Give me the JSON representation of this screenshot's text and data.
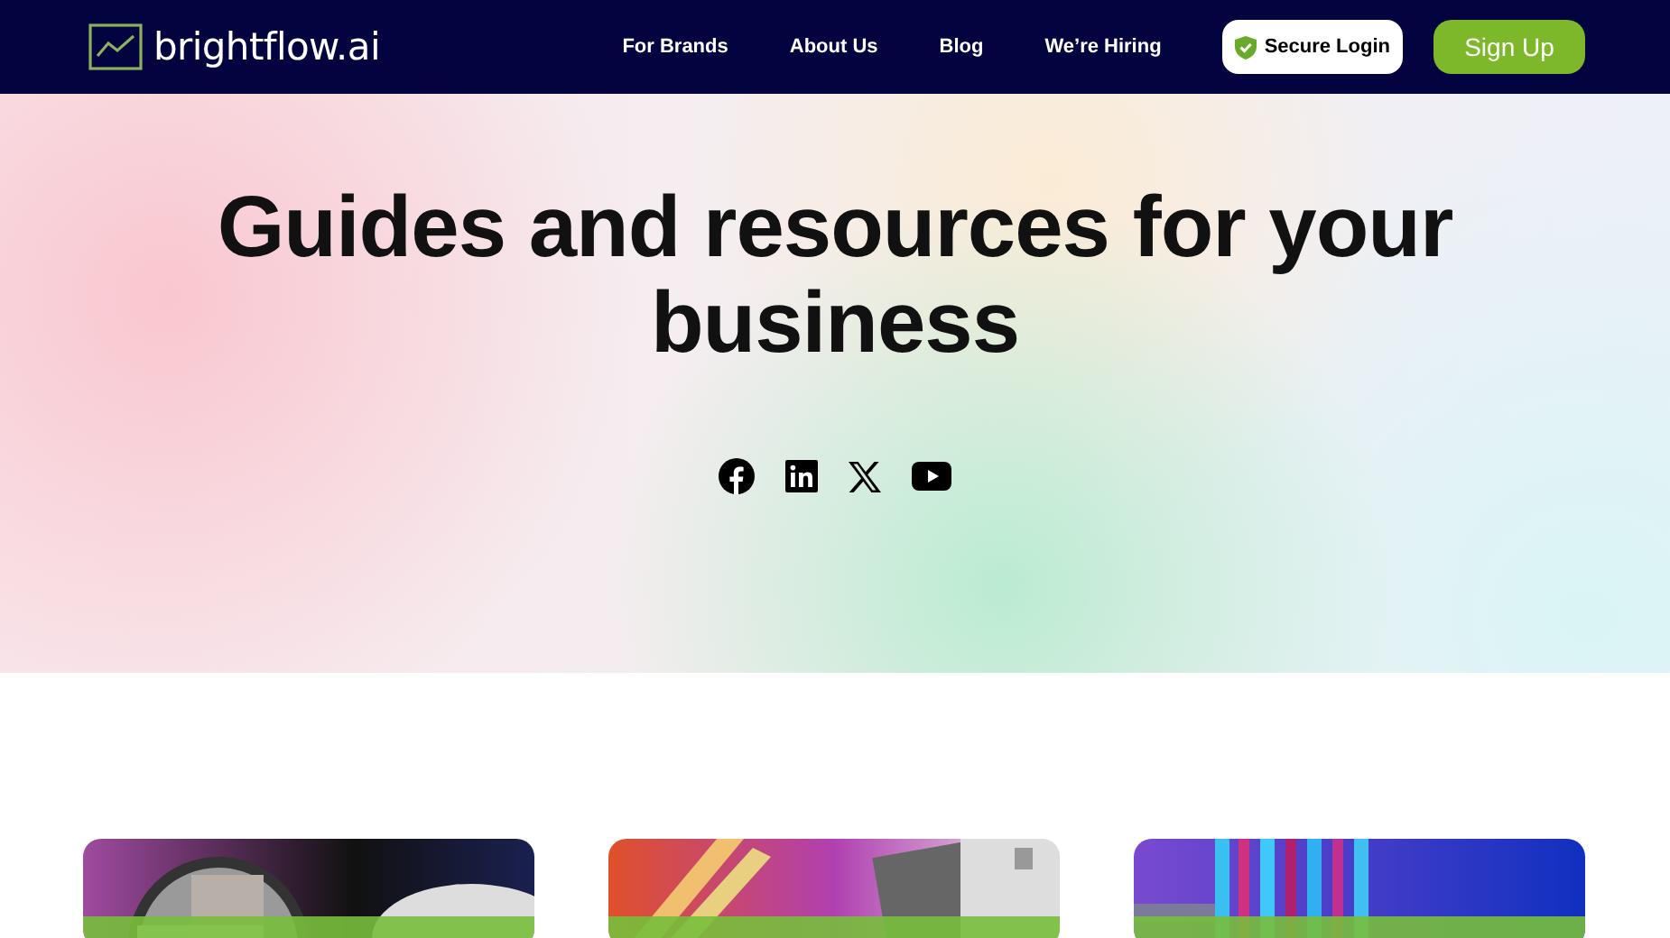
{
  "header": {
    "logo": "brightflow.ai",
    "nav": [
      "For Brands",
      "About Us",
      "Blog",
      "We’re Hiring"
    ],
    "login_button": "Secure Login",
    "signup_button": "Sign Up"
  },
  "hero": {
    "title": "Guides and resources for your business",
    "social": [
      {
        "kind": "facebook"
      },
      {
        "kind": "linkedin"
      },
      {
        "kind": "x"
      },
      {
        "kind": "youtube"
      }
    ]
  }
}
